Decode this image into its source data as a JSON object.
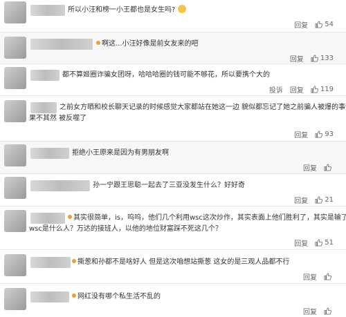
{
  "actions": {
    "reply": "回复",
    "report": "投诉"
  },
  "comments": [
    {
      "text": "所以小汪和榜一小王都也是女生吗?",
      "likes": "54"
    },
    {
      "text": "啊这...小汪好像是前女友来的吧",
      "likes": "133"
    },
    {
      "text": "都不算姬圈诈骗女团呀，哈哈哈圈的钱可能不够花，所以要携个大的",
      "likes": "119"
    },
    {
      "text_line1": "之前女方晒和校长聊天记录的时候感觉大家都站在她这一边 貌似都忘记了她之前骗人被爆的事情",
      "text_line2": "果不其然 被反噬了",
      "likes": "93"
    },
    {
      "text": "拒绝小王原来是因为有男朋友啊",
      "likes": ""
    },
    {
      "text": "孙一宁跟王思聪一起去了三亚没发生什么？好好奇",
      "likes": "21"
    },
    {
      "text_line1": "其实很简单，is，呜呜，他们几个利用wsc这次炒作，其实表面上他们胜利了，其实是输了，",
      "text_line2": "wsc是什么人？万达的接班人，以他的地位财富踩不死这几个？",
      "likes": "51"
    },
    {
      "text": "撕葱和孙都不是啥好人 但是这次咱想站撕葱 这女的是三观人品都不行",
      "likes": ""
    },
    {
      "text": "网红没有哪个私生活不乱的",
      "likes": ""
    }
  ]
}
